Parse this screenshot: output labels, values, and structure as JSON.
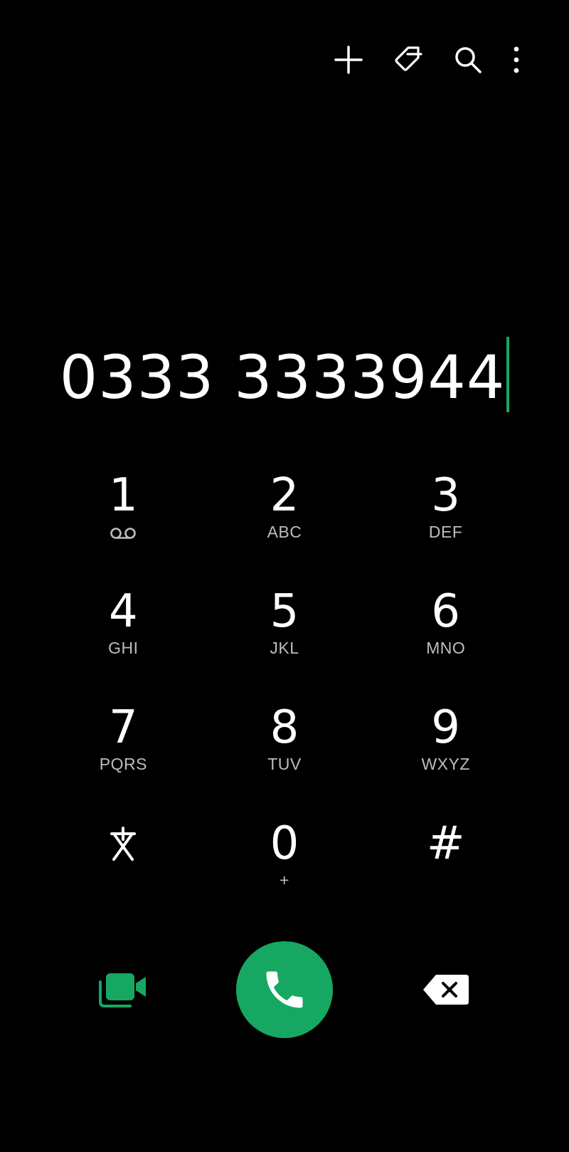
{
  "top_bar": {
    "icons": [
      "add-icon",
      "tag-icon",
      "search-icon",
      "more-vert-icon"
    ]
  },
  "display": {
    "number": "0333 3333944"
  },
  "keypad": {
    "keys": [
      {
        "digit": "1",
        "letters": "",
        "sub_icon": "voicemail-icon"
      },
      {
        "digit": "2",
        "letters": "ABC"
      },
      {
        "digit": "3",
        "letters": "DEF"
      },
      {
        "digit": "4",
        "letters": "GHI"
      },
      {
        "digit": "5",
        "letters": "JKL"
      },
      {
        "digit": "6",
        "letters": "MNO"
      },
      {
        "digit": "7",
        "letters": "PQRS"
      },
      {
        "digit": "8",
        "letters": "TUV"
      },
      {
        "digit": "9",
        "letters": "WXYZ"
      },
      {
        "digit": "⁎",
        "letters": ""
      },
      {
        "digit": "0",
        "letters": "+"
      },
      {
        "digit": "#",
        "letters": ""
      }
    ]
  },
  "actions": {
    "icons": [
      "video-call-icon",
      "phone-icon",
      "backspace-icon"
    ]
  },
  "colors": {
    "background": "#000000",
    "accent": "#16a862",
    "text": "#ffffff",
    "subtext": "#bdbdbd"
  }
}
